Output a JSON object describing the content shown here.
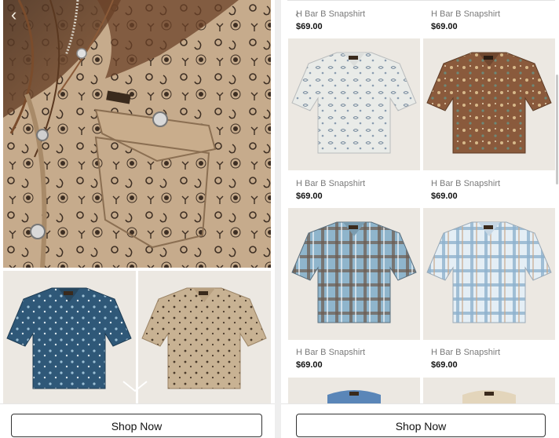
{
  "left_panel": {
    "hero_image": "closeup-tan-paisley-snapshirt",
    "thumbnails": [
      "navy-paisley-snapshirt",
      "tan-paisley-snapshirt"
    ],
    "shop_now_label": "Shop Now"
  },
  "right_panel": {
    "products": [
      {
        "name": "H Bar B Snapshirt",
        "price": "$69.00",
        "image": "",
        "visible_image": false
      },
      {
        "name": "H Bar B Snapshirt",
        "price": "$69.00",
        "image": "",
        "visible_image": false
      },
      {
        "name": "H Bar B Snapshirt",
        "price": "$69.00",
        "image": "white-floral-snapshirt"
      },
      {
        "name": "H Bar B Snapshirt",
        "price": "$69.00",
        "image": "brown-floral-snapshirt"
      },
      {
        "name": "H Bar B Snapshirt",
        "price": "$69.00",
        "image": "blue-plaid-snapshirt"
      },
      {
        "name": "H Bar B Snapshirt",
        "price": "$69.00",
        "image": "light-blue-plaid-snapshirt"
      }
    ],
    "shop_now_label": "Shop Now"
  },
  "colors": {
    "tile_bg": "#ece8e2",
    "navy_shirt": "#2f5878",
    "tan_shirt": "#c8b293",
    "brown_shirt": "#8a5a3c",
    "white_shirt": "#e9ebe8",
    "blue_plaid": "#8fb5cc",
    "light_plaid": "#c9dcea"
  }
}
